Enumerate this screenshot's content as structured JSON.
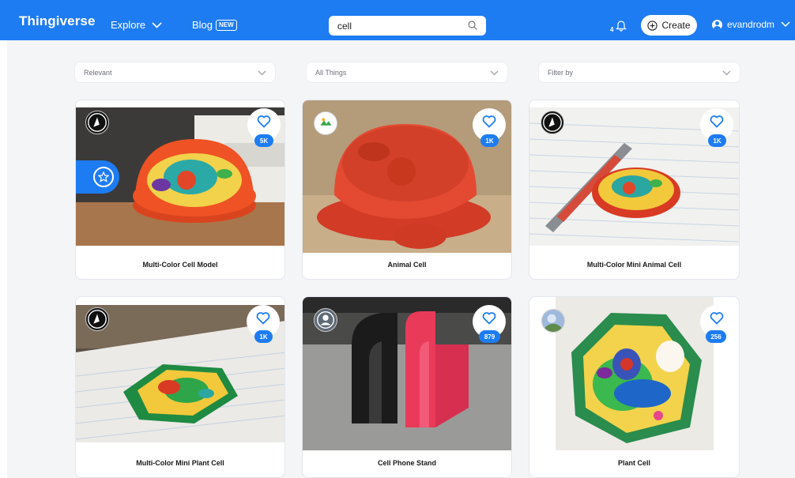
{
  "header": {
    "logo": "Thingiverse",
    "nav": {
      "explore": "Explore",
      "blog": "Blog",
      "blog_badge": "NEW"
    },
    "search": {
      "value": "cell"
    },
    "notifications": {
      "count": "4"
    },
    "create_label": "Create",
    "username": "evandrodm"
  },
  "filters": {
    "sort": "Relevant",
    "type": "All Things",
    "filter": "Filter by"
  },
  "cards": [
    {
      "title": "Multi-Color Cell Model",
      "likes": "5K",
      "featured": true
    },
    {
      "title": "Animal Cell",
      "likes": "1K"
    },
    {
      "title": "Multi-Color Mini Animal Cell",
      "likes": "1K"
    },
    {
      "title": "Multi-Color Mini Plant Cell",
      "likes": "1K"
    },
    {
      "title": "Cell Phone Stand",
      "likes": "879"
    },
    {
      "title": "Plant Cell",
      "likes": "256"
    }
  ],
  "colors": {
    "brand": "#1e7cf2",
    "background": "#f4f5f7"
  },
  "icons": [
    "chevron-down-icon",
    "search-icon",
    "bell-icon",
    "plus-circle-icon",
    "user-icon",
    "heart-icon",
    "star-icon"
  ]
}
